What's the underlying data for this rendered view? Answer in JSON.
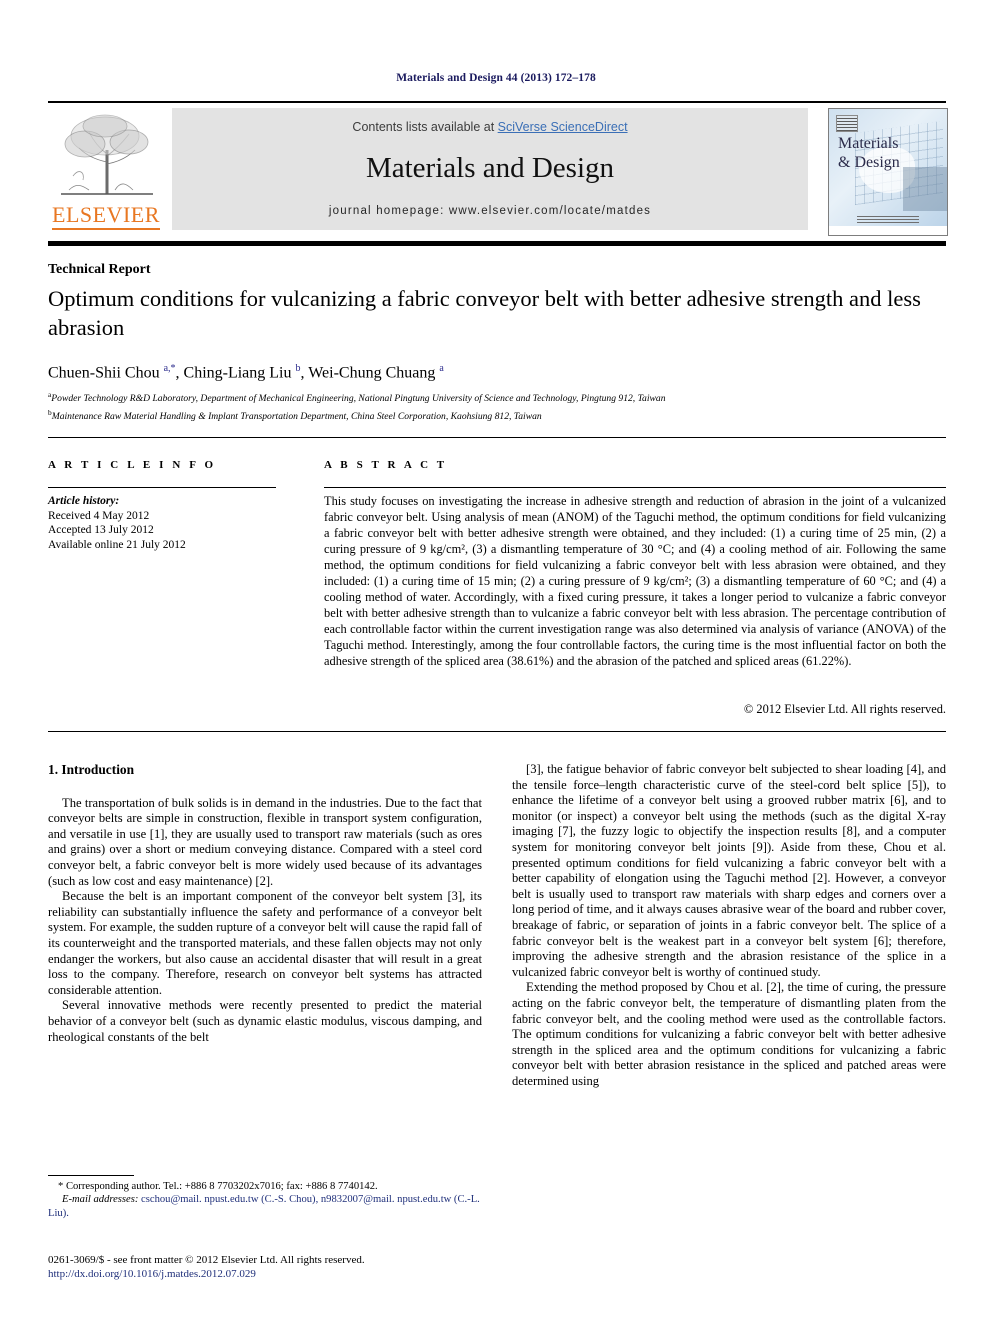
{
  "running_head": "Materials and Design 44 (2013) 172–178",
  "masthead": {
    "contents_prefix": "Contents lists available at ",
    "sciencedirect": "SciVerse ScienceDirect",
    "journal_title": "Materials and Design",
    "homepage": "journal homepage: www.elsevier.com/locate/matdes",
    "publisher_wordmark": "ELSEVIER",
    "cover_title_line1": "Materials",
    "cover_title_line2": "& Design"
  },
  "article": {
    "type": "Technical Report",
    "title": "Optimum conditions for vulcanizing a fabric conveyor belt with better adhesive strength and less abrasion",
    "authors_html": "Chuen-Shii Chou <sup>a,*</sup>, Ching-Liang Liu <sup>b</sup>, Wei-Chung Chuang <sup>a</sup>",
    "affiliations": [
      {
        "marker": "a",
        "text": "Powder Technology R&D Laboratory, Department of Mechanical Engineering, National Pingtung University of Science and Technology, Pingtung 912, Taiwan"
      },
      {
        "marker": "b",
        "text": "Maintenance Raw Material Handling & Implant Transportation Department, China Steel Corporation, Kaohsiung 812, Taiwan"
      }
    ]
  },
  "info": {
    "heading": "A R T I C L E   I N F O",
    "history_label": "Article history:",
    "history": [
      "Received 4 May 2012",
      "Accepted 13 July 2012",
      "Available online 21 July 2012"
    ]
  },
  "abstract": {
    "heading": "A B S T R A C T",
    "text": "This study focuses on investigating the increase in adhesive strength and reduction of abrasion in the joint of a vulcanized fabric conveyor belt. Using analysis of mean (ANOM) of the Taguchi method, the optimum conditions for field vulcanizing a fabric conveyor belt with better adhesive strength were obtained, and they included: (1) a curing time of 25 min, (2) a curing pressure of 9 kg/cm², (3) a dismantling temperature of 30 °C; and (4) a cooling method of air. Following the same method, the optimum conditions for field vulcanizing a fabric conveyor belt with less abrasion were obtained, and they included: (1) a curing time of 15 min; (2) a curing pressure of 9 kg/cm²; (3) a dismantling temperature of 60 °C; and (4) a cooling method of water. Accordingly, with a fixed curing pressure, it takes a longer period to vulcanize a fabric conveyor belt with better adhesive strength than to vulcanize a fabric conveyor belt with less abrasion. The percentage contribution of each controllable factor within the current investigation range was also determined via analysis of variance (ANOVA) of the Taguchi method. Interestingly, among the four controllable factors, the curing time is the most influential factor on both the adhesive strength of the spliced area (38.61%) and the abrasion of the patched and spliced areas (61.22%).",
    "copyright": "© 2012 Elsevier Ltd. All rights reserved."
  },
  "body": {
    "section_heading": "1. Introduction",
    "left_paragraphs": [
      "The transportation of bulk solids is in demand in the industries. Due to the fact that conveyor belts are simple in construction, flexible in transport system configuration, and versatile in use [1], they are usually used to transport raw materials (such as ores and grains) over a short or medium conveying distance. Compared with a steel cord conveyor belt, a fabric conveyor belt is more widely used because of its advantages (such as low cost and easy maintenance) [2].",
      "Because the belt is an important component of the conveyor belt system [3], its reliability can substantially influence the safety and performance of a conveyor belt system. For example, the sudden rupture of a conveyor belt will cause the rapid fall of its counterweight and the transported materials, and these fallen objects may not only endanger the workers, but also cause an accidental disaster that will result in a great loss to the company. Therefore, research on conveyor belt systems has attracted considerable attention.",
      "Several innovative methods were recently presented to predict the material behavior of a conveyor belt (such as dynamic elastic modulus, viscous damping, and rheological constants of the belt"
    ],
    "right_paragraphs": [
      "[3], the fatigue behavior of fabric conveyor belt subjected to shear loading [4], and the tensile force–length characteristic curve of the steel-cord belt splice [5]), to enhance the lifetime of a conveyor belt using a grooved rubber matrix [6], and to monitor (or inspect) a conveyor belt using the methods (such as the digital X-ray imaging [7], the fuzzy logic to objectify the inspection results [8], and a computer system for monitoring conveyor belt joints [9]). Aside from these, Chou et al. presented optimum conditions for field vulcanizing a fabric conveyor belt with a better capability of elongation using the Taguchi method [2]. However, a conveyor belt is usually used to transport raw materials with sharp edges and corners over a long period of time, and it always causes abrasive wear of the board and rubber cover, breakage of fabric, or separation of joints in a fabric conveyor belt. The splice of a fabric conveyor belt is the weakest part in a conveyor belt system [6]; therefore, improving the adhesive strength and the abrasion resistance of the splice in a vulcanized fabric conveyor belt is worthy of continued study.",
      "Extending the method proposed by Chou et al. [2], the time of curing, the pressure acting on the fabric conveyor belt, the temperature of dismantling platen from the fabric conveyor belt, and the cooling method were used as the controllable factors. The optimum conditions for vulcanizing a fabric conveyor belt with better adhesive strength in the spliced area and the optimum conditions for vulcanizing a fabric conveyor belt with better abrasion resistance in the spliced and patched areas were determined using"
    ]
  },
  "footnote": {
    "corresponding": "* Corresponding author. Tel.: +886 8 7703202x7016; fax: +886 8 7740142.",
    "email_label": "E-mail addresses:",
    "email_text": " cschou@mail. npust.edu.tw (C.-S. Chou), n9832007@mail. npust.edu.tw (C.-L. Liu)."
  },
  "imprint": {
    "issn_line": "0261-3069/$ - see front matter © 2012 Elsevier Ltd. All rights reserved.",
    "doi": "http://dx.doi.org/10.1016/j.matdes.2012.07.029"
  },
  "colors": {
    "elsevier_orange": "#E87722",
    "link_blue": "#1f2f7a",
    "sciencedirect_blue": "#3b6fb6",
    "banner_gray": "#e3e3e3"
  }
}
